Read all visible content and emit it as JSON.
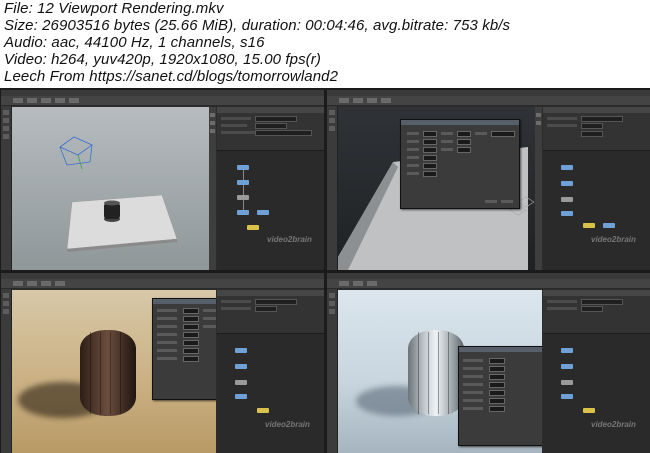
{
  "info": {
    "file": "File: 12 Viewport Rendering.mkv",
    "size": "Size: 26903516 bytes (25.66 MiB), duration: 00:04:46, avg.bitrate: 753 kb/s",
    "audio": "Audio: aac, 44100 Hz, 1 channels, s16",
    "video": "Video: h264, yuv420p, 1920x1080, 15.00 fps(r)",
    "leech": "Leech From https://sanet.cd/blogs/tomorrowland2"
  },
  "thumbnails": [
    {
      "scene": "grey-viewport-barrel-on-plane",
      "watermark": "video2brain"
    },
    {
      "scene": "dark-viewport-render-dialog",
      "watermark": "video2brain"
    },
    {
      "scene": "tan-lit-barrel-with-settings-dialog",
      "watermark": "video2brain"
    },
    {
      "scene": "blue-lit-white-barrel-with-settings-dialog",
      "watermark": "video2brain"
    }
  ],
  "colors": {
    "node_blue": "#6fa0d6",
    "node_yellow": "#d9c24a",
    "app_bg": "#2c2c2c"
  }
}
